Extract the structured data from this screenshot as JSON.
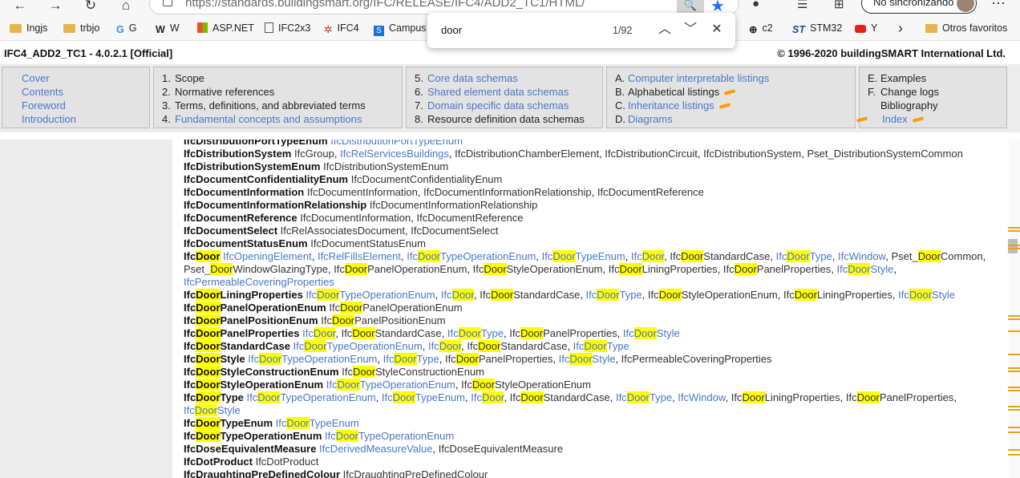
{
  "browser": {
    "url": "https://standards.buildingsmart.org/IFC/RELEASE/IFC4/ADD2_TC1/HTML/",
    "profile_label": "No sincronizando",
    "bookmarks": [
      "Ingjs",
      "trbjo",
      "G",
      "W",
      "ASP.NET",
      "IFC2x3",
      "IFC4",
      "Campus",
      "c2",
      "STM32",
      "Y",
      "Otros favoritos"
    ]
  },
  "find": {
    "query": "door",
    "count": "1/92"
  },
  "header": {
    "title": "IFC4_ADD2_TC1 - 4.0.2.1 [Official]",
    "copyright": "© 1996-2020 buildingSMART International Ltd."
  },
  "nav": {
    "col1": [
      "Cover",
      "Contents",
      "Foreword",
      "Introduction"
    ],
    "col2": [
      {
        "num": "1.",
        "label": "Scope"
      },
      {
        "num": "2.",
        "label": "Normative references"
      },
      {
        "num": "3.",
        "label": "Terms, definitions, and abbreviated terms"
      },
      {
        "num": "4.",
        "label": "Fundamental concepts and assumptions"
      }
    ],
    "col3": [
      {
        "num": "5.",
        "label": "Core data schemas"
      },
      {
        "num": "6.",
        "label": "Shared element data schemas"
      },
      {
        "num": "7.",
        "label": "Domain specific data schemas"
      },
      {
        "num": "8.",
        "label": "Resource definition data schemas"
      }
    ],
    "col4": [
      {
        "num": "A.",
        "label": "Computer interpretable listings"
      },
      {
        "num": "B.",
        "label": "Alphabetical listings"
      },
      {
        "num": "C.",
        "label": "Inheritance listings"
      },
      {
        "num": "D.",
        "label": "Diagrams"
      }
    ],
    "col5": [
      {
        "num": "E.",
        "label": "Examples"
      },
      {
        "num": "F.",
        "label": "Change logs"
      },
      {
        "num": "",
        "label": "Bibliography"
      },
      {
        "num": "",
        "label": "Index"
      }
    ]
  },
  "index_rows": [
    "IfcDistributionPortTypeEnum|~IfcDistributionPortTypeEnum",
    "IfcDistributionSystem|IfcGroup, ~IfcRelServicesBuildings, IfcDistributionChamberElement, IfcDistributionCircuit, IfcDistributionSystem, Pset_DistributionSystemCommon",
    "IfcDistributionSystemEnum|IfcDistributionSystemEnum",
    "IfcDocumentConfidentialityEnum|IfcDocumentConfidentialityEnum",
    "IfcDocumentInformation|IfcDocumentInformation, IfcDocumentInformationRelationship, IfcDocumentReference",
    "IfcDocumentInformationRelationship|IfcDocumentInformationRelationship",
    "IfcDocumentReference|IfcDocumentInformation, IfcDocumentReference",
    "IfcDocumentSelect|IfcRelAssociatesDocument, IfcDocumentSelect",
    "IfcDocumentStatusEnum|IfcDocumentStatusEnum",
    "IfcDoor|~IfcOpeningElement, ~IfcRelFillsElement, ~IfcDoorTypeOperationEnum, ~IfcDoorTypeEnum, ~IfcDoor, IfcDoorStandardCase, ~IfcDoorType, ~IfcWindow, Pset_DoorCommon,",
    "|Pset_DoorWindowGlazingType, IfcDoorPanelOperationEnum, IfcDoorStyleOperationEnum, IfcDoorLiningProperties, IfcDoorPanelProperties, ~IfcDoorStyle,",
    "|~IfcPermeableCoveringProperties",
    "IfcDoorLiningProperties|~IfcDoorTypeOperationEnum, ~IfcDoor, IfcDoorStandardCase, ~IfcDoorType, IfcDoorStyleOperationEnum, IfcDoorLiningProperties, ~IfcDoorStyle",
    "IfcDoorPanelOperationEnum|IfcDoorPanelOperationEnum",
    "IfcDoorPanelPositionEnum|IfcDoorPanelPositionEnum",
    "IfcDoorPanelProperties|~IfcDoor, IfcDoorStandardCase, ~IfcDoorType, IfcDoorPanelProperties, ~IfcDoorStyle",
    "IfcDoorStandardCase|~IfcDoorTypeOperationEnum, ~IfcDoor, IfcDoorStandardCase, ~IfcDoorType",
    "IfcDoorStyle|~IfcDoorTypeOperationEnum, ~IfcDoorType, IfcDoorPanelProperties, ~IfcDoorStyle, IfcPermeableCoveringProperties",
    "IfcDoorStyleConstructionEnum|IfcDoorStyleConstructionEnum",
    "IfcDoorStyleOperationEnum|~IfcDoorTypeOperationEnum, IfcDoorStyleOperationEnum",
    "IfcDoorType|~IfcDoorTypeOperationEnum, ~IfcDoorTypeEnum, ~IfcDoor, IfcDoorStandardCase, ~IfcDoorType, ~IfcWindow, IfcDoorLiningProperties, IfcDoorPanelProperties,",
    "|~IfcDoorStyle",
    "IfcDoorTypeEnum|~IfcDoorTypeEnum",
    "IfcDoorTypeOperationEnum|~IfcDoorTypeOperationEnum",
    "IfcDoseEquivalentMeasure|~IfcDerivedMeasureValue, IfcDoseEquivalentMeasure",
    "IfcDotProduct|IfcDotProduct",
    "IfcDraughtingPreDefinedColour|IfcDraughtingPreDefinedColour"
  ],
  "colors": {
    "link": "#4a77c9",
    "highlight": "#ffff00",
    "marker": "#ff9a00"
  }
}
